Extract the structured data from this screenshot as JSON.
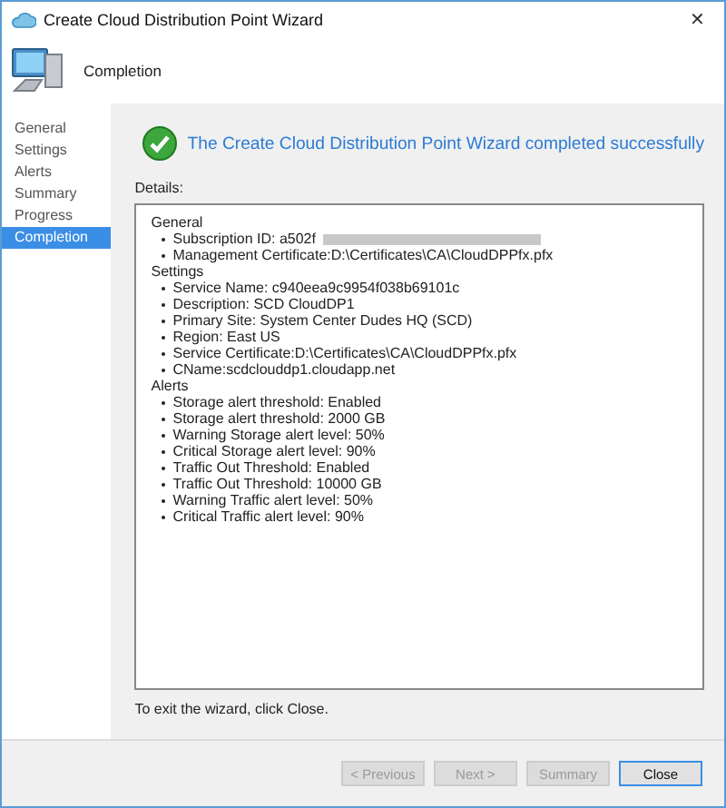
{
  "window": {
    "title": "Create Cloud Distribution Point Wizard",
    "close": "✕"
  },
  "header": {
    "title": "Completion"
  },
  "sidebar": {
    "items": [
      {
        "label": "General",
        "selected": false
      },
      {
        "label": "Settings",
        "selected": false
      },
      {
        "label": "Alerts",
        "selected": false
      },
      {
        "label": "Summary",
        "selected": false
      },
      {
        "label": "Progress",
        "selected": false
      },
      {
        "label": "Completion",
        "selected": true
      }
    ]
  },
  "result": {
    "message": "The Create Cloud Distribution Point Wizard completed successfully"
  },
  "details": {
    "label": "Details:",
    "sections": [
      {
        "heading": "General",
        "items": [
          {
            "text": "Subscription ID: a502f",
            "redacted": true
          },
          {
            "text": "Management Certificate:D:\\Certificates\\CA\\CloudDPPfx.pfx",
            "redacted": false
          }
        ]
      },
      {
        "heading": "Settings",
        "items": [
          {
            "text": "Service Name: c940eea9c9954f038b69101c",
            "redacted": false
          },
          {
            "text": "Description: SCD CloudDP1",
            "redacted": false
          },
          {
            "text": "Primary Site: System Center Dudes HQ (SCD)",
            "redacted": false
          },
          {
            "text": "Region: East US",
            "redacted": false
          },
          {
            "text": "Service Certificate:D:\\Certificates\\CA\\CloudDPPfx.pfx",
            "redacted": false
          },
          {
            "text": "CName:scdclouddp1.cloudapp.net",
            "redacted": false
          }
        ]
      },
      {
        "heading": "Alerts",
        "items": [
          {
            "text": "Storage alert threshold: Enabled",
            "redacted": false
          },
          {
            "text": "Storage alert threshold: 2000 GB",
            "redacted": false
          },
          {
            "text": "Warning Storage alert level: 50%",
            "redacted": false
          },
          {
            "text": "Critical Storage alert level: 90%",
            "redacted": false
          },
          {
            "text": "Traffic Out Threshold: Enabled",
            "redacted": false
          },
          {
            "text": "Traffic Out Threshold: 10000 GB",
            "redacted": false
          },
          {
            "text": "Warning Traffic alert level: 50%",
            "redacted": false
          },
          {
            "text": "Critical Traffic alert level: 90%",
            "redacted": false
          }
        ]
      }
    ]
  },
  "footer_text": "To exit the wizard, click Close.",
  "buttons": [
    {
      "label": "< Previous",
      "disabled": true,
      "default": false
    },
    {
      "label": "Next >",
      "disabled": true,
      "default": false
    },
    {
      "label": "Summary",
      "disabled": true,
      "default": false
    },
    {
      "label": "Close",
      "disabled": false,
      "default": true
    }
  ]
}
